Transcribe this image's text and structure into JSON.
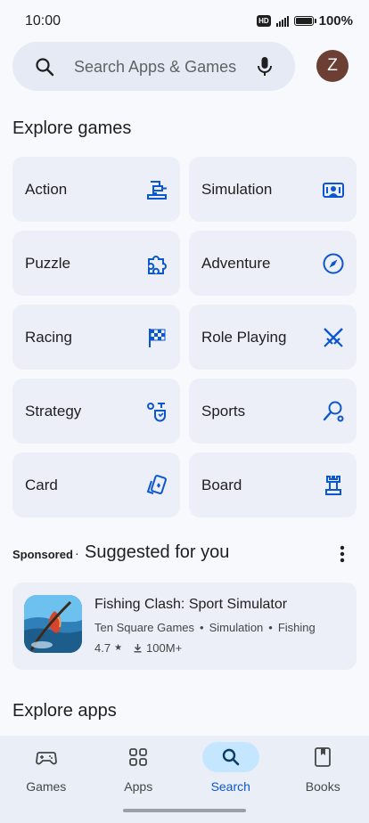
{
  "status_bar": {
    "time": "10:00",
    "hd": "HD",
    "battery": "100%",
    "battery_level": 1.0
  },
  "search": {
    "placeholder": "Search Apps & Games",
    "avatar_letter": "Z"
  },
  "explore_games": {
    "title": "Explore games",
    "categories": [
      {
        "label": "Action",
        "icon": "action-icon"
      },
      {
        "label": "Simulation",
        "icon": "simulation-icon"
      },
      {
        "label": "Puzzle",
        "icon": "puzzle-icon"
      },
      {
        "label": "Adventure",
        "icon": "compass-icon"
      },
      {
        "label": "Racing",
        "icon": "checkered-flag-icon"
      },
      {
        "label": "Role Playing",
        "icon": "crossed-swords-icon"
      },
      {
        "label": "Strategy",
        "icon": "strategy-icon"
      },
      {
        "label": "Sports",
        "icon": "sports-icon"
      },
      {
        "label": "Card",
        "icon": "cards-icon"
      },
      {
        "label": "Board",
        "icon": "chess-rook-icon"
      }
    ]
  },
  "suggested": {
    "sponsored_label": "Sponsored",
    "separator": "·",
    "title": "Suggested for you",
    "app": {
      "name": "Fishing Clash: Sport Simulator",
      "developer": "Ten Square Games",
      "genre1": "Simulation",
      "genre2": "Fishing",
      "meta_sep": "•",
      "rating": "4.7",
      "star": "★",
      "downloads": "100M+"
    }
  },
  "explore_apps": {
    "title": "Explore apps"
  },
  "bottom_nav": {
    "items": [
      {
        "label": "Games",
        "icon": "gamepad-icon",
        "active": false
      },
      {
        "label": "Apps",
        "icon": "apps-grid-icon",
        "active": false
      },
      {
        "label": "Search",
        "icon": "search-icon",
        "active": true
      },
      {
        "label": "Books",
        "icon": "book-icon",
        "active": false
      }
    ]
  },
  "colors": {
    "accent": "#0b57d0",
    "active_pill": "#c4e7ff",
    "tile_bg": "#eceff8",
    "avatar_bg": "#6b3f34"
  }
}
